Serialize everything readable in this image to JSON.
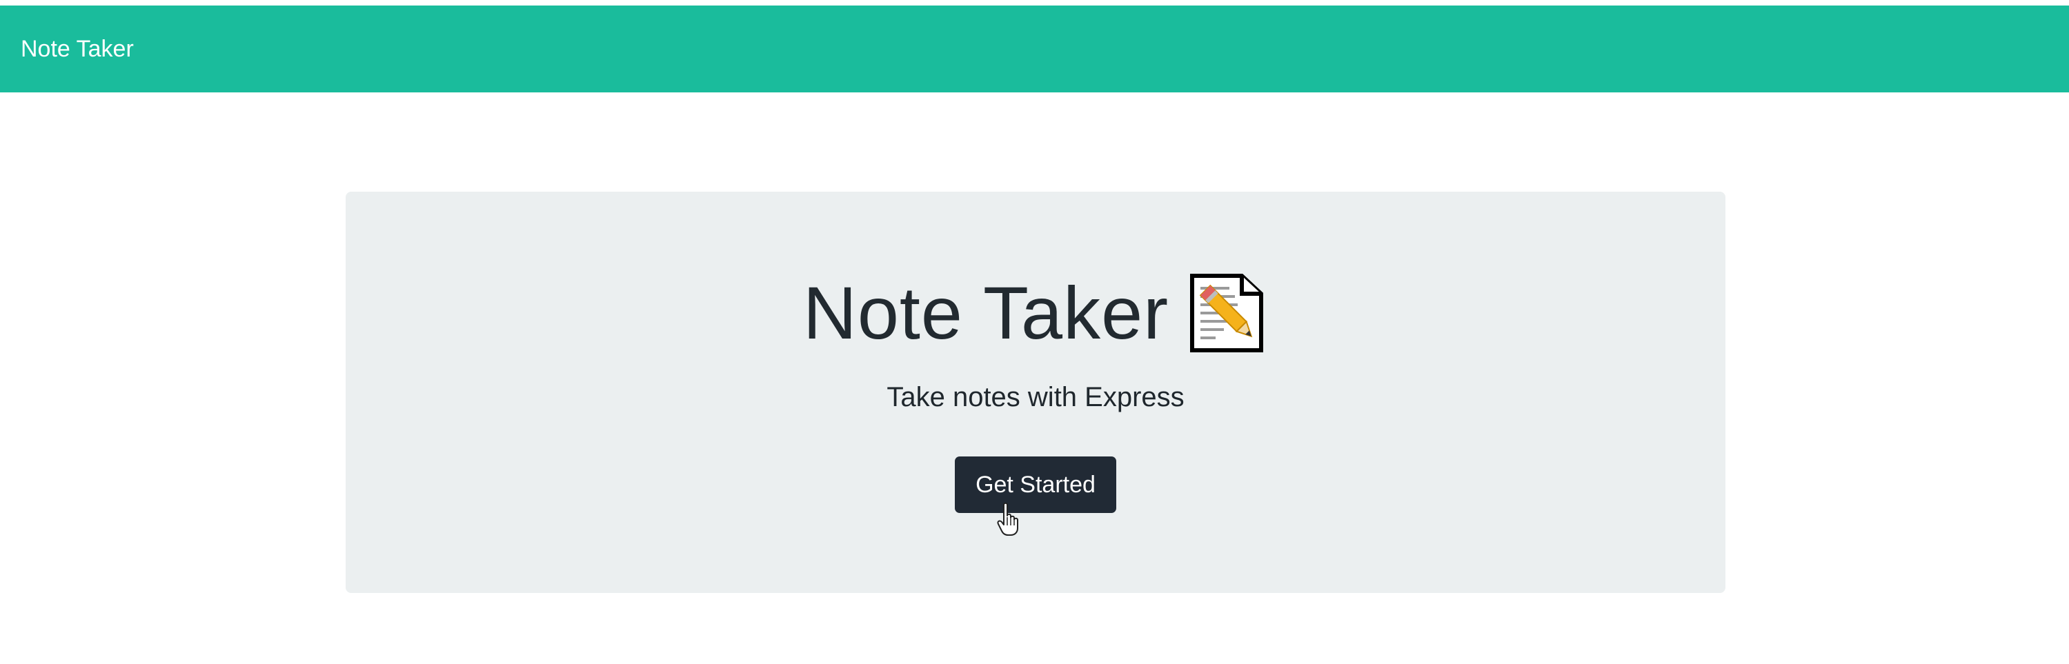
{
  "navbar": {
    "brand": "Note Taker",
    "color": "#1abc9c"
  },
  "hero": {
    "title": "Note Taker",
    "icon": "memo-icon",
    "subtitle": "Take notes with Express",
    "background": "#ebeff0"
  },
  "cta": {
    "label": "Get Started",
    "color": "#212a35"
  }
}
